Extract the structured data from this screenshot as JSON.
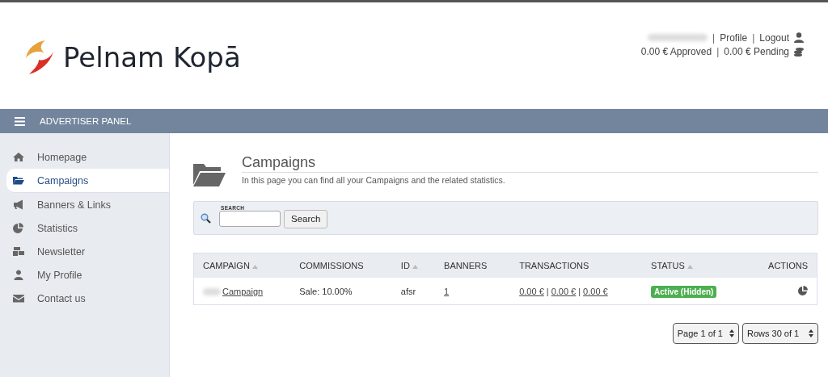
{
  "header": {
    "logo_text": "Pelnam Kopā",
    "account_row": [
      {
        "kind": "separator",
        "text": "|"
      },
      {
        "kind": "link",
        "text": "Profile"
      },
      {
        "kind": "separator",
        "text": "|"
      },
      {
        "kind": "link",
        "text": "Logout"
      }
    ],
    "balance_row": [
      {
        "kind": "text",
        "text": "0.00 € Approved"
      },
      {
        "kind": "separator",
        "text": "|"
      },
      {
        "kind": "text",
        "text": "0.00 € Pending"
      }
    ]
  },
  "navbar": {
    "title": "ADVERTISER PANEL"
  },
  "sidebar": {
    "items": [
      {
        "label": "Homepage",
        "kind": "home",
        "selected": false
      },
      {
        "label": "Campaigns",
        "kind": "folder",
        "selected": true
      },
      {
        "label": "Banners & Links",
        "kind": "megaphone",
        "selected": false
      },
      {
        "label": "Statistics",
        "kind": "pie",
        "selected": false
      },
      {
        "label": "Newsletter",
        "kind": "newsletter",
        "selected": false
      },
      {
        "label": "My Profile",
        "kind": "user",
        "selected": false
      },
      {
        "label": "Contact us",
        "kind": "mail",
        "selected": false
      }
    ]
  },
  "page": {
    "title": "Campaigns",
    "subtitle": "In this page you can find all your Campaigns and the related statistics."
  },
  "search": {
    "label": "SEARCH",
    "button": "Search"
  },
  "table": {
    "columns": [
      {
        "label": "CAMPAIGN",
        "sortable": true
      },
      {
        "label": "COMMISSIONS",
        "sortable": false
      },
      {
        "label": "ID",
        "sortable": true
      },
      {
        "label": "BANNERS",
        "sortable": false
      },
      {
        "label": "TRANSACTIONS",
        "sortable": false
      },
      {
        "label": "STATUS",
        "sortable": true
      },
      {
        "label": "ACTIONS",
        "sortable": false
      }
    ],
    "rows": [
      {
        "campaign": "Campaign",
        "commissions": "Sale: 10.00%",
        "id": "afsr",
        "banners": "1",
        "transactions": [
          {
            "kind": "link",
            "text": "0.00 €"
          },
          {
            "kind": "separator",
            "text": "|"
          },
          {
            "kind": "link",
            "text": "0.00 €"
          },
          {
            "kind": "separator",
            "text": "|"
          },
          {
            "kind": "link",
            "text": "0.00 €"
          }
        ],
        "status": "Active (Hidden)",
        "color": "#4caf50"
      }
    ]
  },
  "pager": {
    "page": "Page 1 of 1",
    "rows": "Rows 30 of 1"
  }
}
